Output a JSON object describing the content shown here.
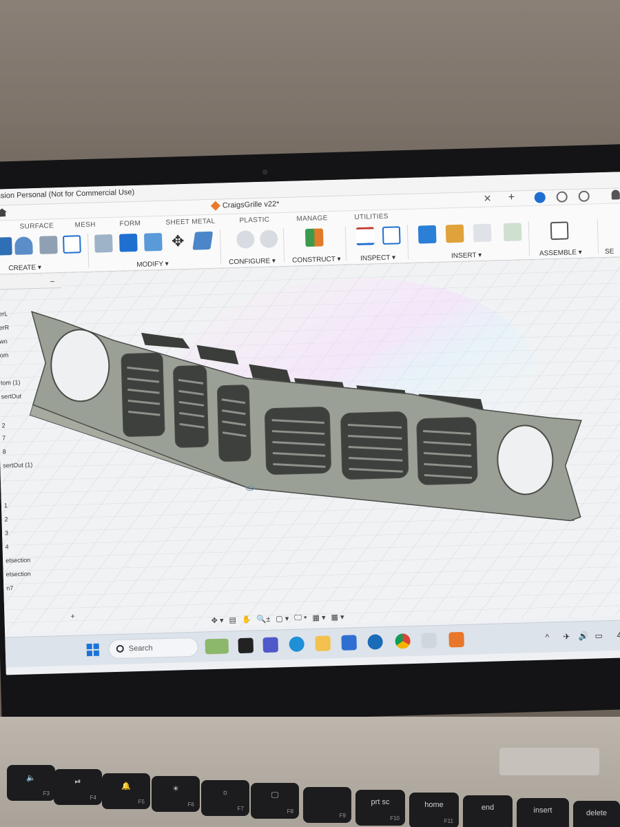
{
  "window": {
    "title": "ssion Personal (Not for Commercial Use)"
  },
  "document_tab": {
    "name": "CraigsGrille v22*"
  },
  "ribbon": {
    "tabs": [
      "SURFACE",
      "MESH",
      "FORM",
      "SHEET METAL",
      "PLASTIC",
      "MANAGE",
      "UTILITIES"
    ],
    "groups": {
      "create": "CREATE ▾",
      "modify": "MODIFY ▾",
      "configure": "CONFIGURE ▾",
      "construct": "CONSTRUCT ▾",
      "inspect": "INSPECT ▾",
      "insert": "INSERT ▾",
      "assemble": "ASSEMBLE ▾",
      "select_partial": "SE"
    }
  },
  "browser": {
    "items": [
      "erL",
      "erR",
      "wn",
      "om",
      "tom (1)",
      "sertOut",
      "2",
      "7",
      "8",
      "sertOut (1)",
      "1",
      "2",
      "3",
      "4",
      "etsection",
      "etsection",
      "n7"
    ]
  },
  "navbar": {
    "items": [
      "✥ ▾",
      "▤",
      "✋",
      "🔍±",
      "▢ ▾",
      "🖵 ▾",
      "▦ ▾",
      "▦ ▾"
    ]
  },
  "taskbar": {
    "search_placeholder": "Search",
    "tray_time_partial": "4/"
  },
  "keyboard": {
    "keys": [
      {
        "label": "🔈",
        "fn": "F3"
      },
      {
        "label": "⏯",
        "fn": "F4"
      },
      {
        "label": "🔔",
        "fn": "F5"
      },
      {
        "label": "☀",
        "fn": "F6"
      },
      {
        "label": "☼",
        "fn": "F7"
      },
      {
        "label": "🖵",
        "fn": "F8"
      },
      {
        "label": "",
        "fn": "F9"
      },
      {
        "label": "prt sc",
        "fn": "F10"
      },
      {
        "label": "home",
        "fn": "F11"
      },
      {
        "label": "end",
        "fn": ""
      },
      {
        "label": "insert",
        "fn": ""
      },
      {
        "label": "delete",
        "fn": ""
      }
    ]
  },
  "colors": {
    "accent_blue": "#1f6fd1",
    "grille_body": "#9aa096",
    "grille_shadow": "#4b4d49",
    "viewport_bg": "#f1f2f4"
  }
}
